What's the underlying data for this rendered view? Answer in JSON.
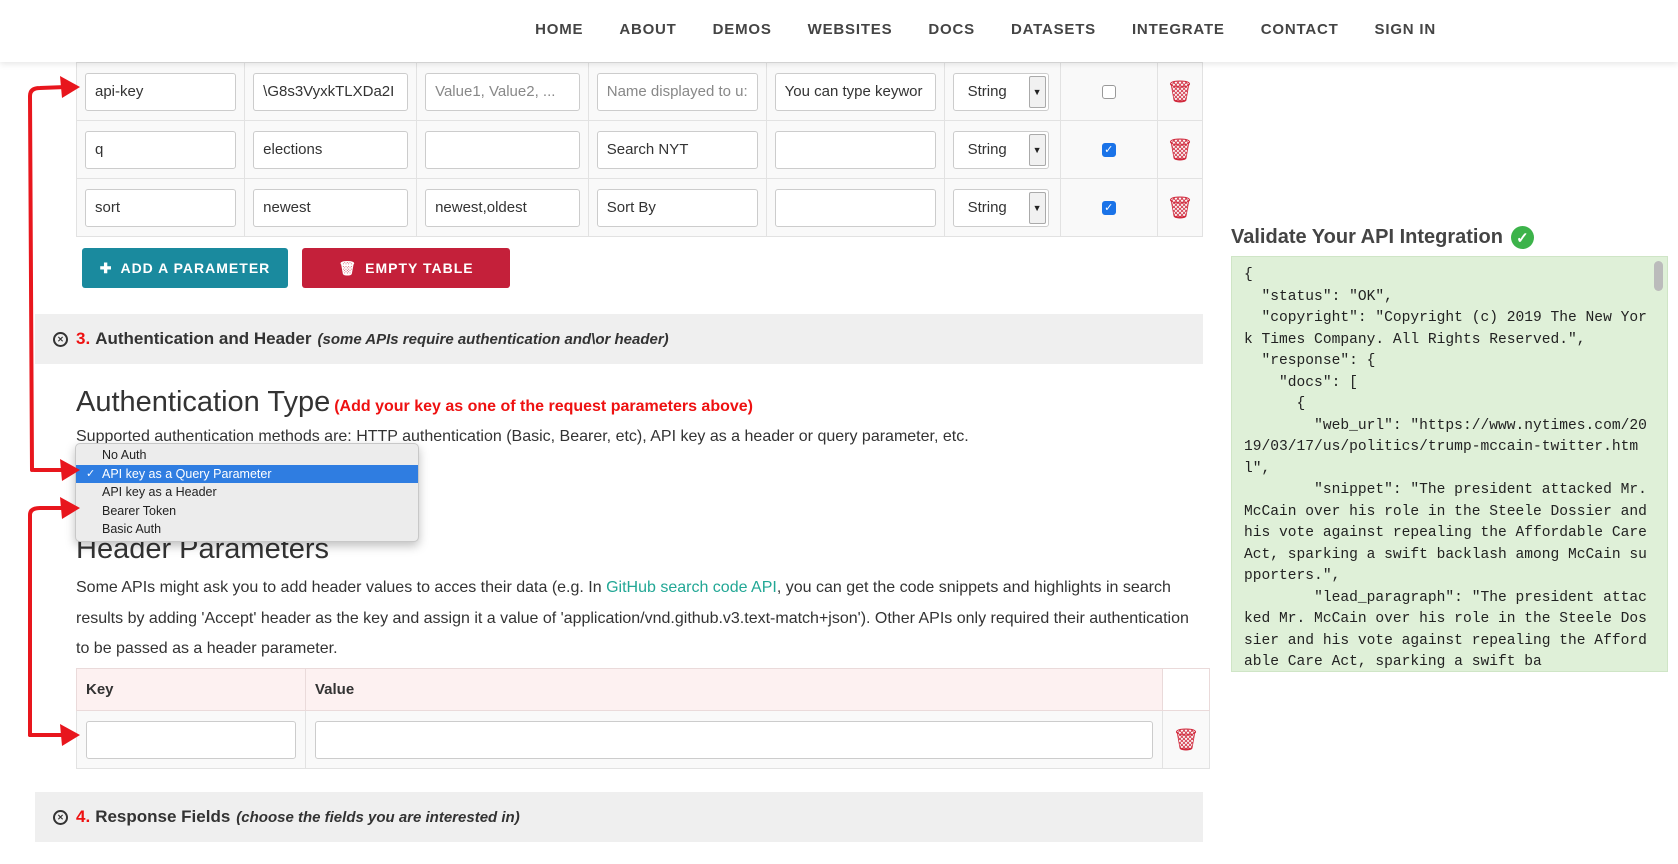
{
  "nav": [
    "HOME",
    "ABOUT",
    "DEMOS",
    "WEBSITES",
    "DOCS",
    "DATASETS",
    "INTEGRATE",
    "CONTACT",
    "SIGN IN"
  ],
  "params": [
    {
      "key": "api-key",
      "value": "\\G8s3VyxkTLXDa2I",
      "options": "Value1, Value2, ...",
      "display": "Name displayed to u:",
      "desc": "You can type keywor",
      "type": "String",
      "checked": false,
      "options_ph": true,
      "display_ph": true,
      "desc_ph": false
    },
    {
      "key": "q",
      "value": "elections",
      "options": "",
      "display": "Search NYT",
      "desc": "",
      "type": "String",
      "checked": true,
      "options_ph": false,
      "display_ph": false,
      "desc_ph": false
    },
    {
      "key": "sort",
      "value": "newest",
      "options": "newest,oldest",
      "display": "Sort By",
      "desc": "",
      "type": "String",
      "checked": true,
      "options_ph": false,
      "display_ph": false,
      "desc_ph": false
    }
  ],
  "buttons": {
    "add": "ADD A PARAMETER",
    "empty": "EMPTY TABLE"
  },
  "section3": {
    "num": "3.",
    "title": "Authentication and Header",
    "note": "(some APIs require authentication and\\or header)"
  },
  "auth": {
    "title": "Authentication Type",
    "note": "(Add your key as one of the request parameters above)",
    "supported": "Supported authentication methods are: HTTP authentication (Basic, Bearer, etc), API key as a header or query parameter, etc.",
    "options": [
      "No Auth",
      "API key as a Query Parameter",
      "API key as a Header",
      "Bearer Token",
      "Basic Auth"
    ],
    "selected": "API key as a Query Parameter"
  },
  "header_params": {
    "title": "Header Parameters",
    "para_before": "Some APIs might ask you to add header values to acces their data (e.g. In ",
    "link": "GitHub search code API",
    "para_after": ", you can get the code snippets and highlights in search results by adding 'Accept' header as the key and assign it a value of 'application/vnd.github.v3.text-match+json'). Other APIs only required their authentication to be passed as a header parameter.",
    "col_key": "Key",
    "col_value": "Value"
  },
  "section4": {
    "num": "4.",
    "title": "Response Fields",
    "note": "(choose the fields you are interested in)"
  },
  "validate": {
    "title": "Validate Your API Integration",
    "json": "{\n  \"status\": \"OK\",\n  \"copyright\": \"Copyright (c) 2019 The New York Times Company. All Rights Reserved.\",\n  \"response\": {\n    \"docs\": [\n      {\n        \"web_url\": \"https://www.nytimes.com/2019/03/17/us/politics/trump-mccain-twitter.html\",\n        \"snippet\": \"The president attacked Mr. McCain over his role in the Steele Dossier and his vote against repealing the Affordable Care Act, sparking a swift backlash among McCain supporters.\",\n        \"lead_paragraph\": \"The president attacked Mr. McCain over his role in the Steele Dossier and his vote against repealing the Affordable Care Act, sparking a swift ba"
  },
  "colors": {
    "accent_teal": "#1a8a9e",
    "danger_red": "#c4203a",
    "json_bg": "#dff0d8",
    "link": "#22a795",
    "annotation": "#e8161d"
  }
}
